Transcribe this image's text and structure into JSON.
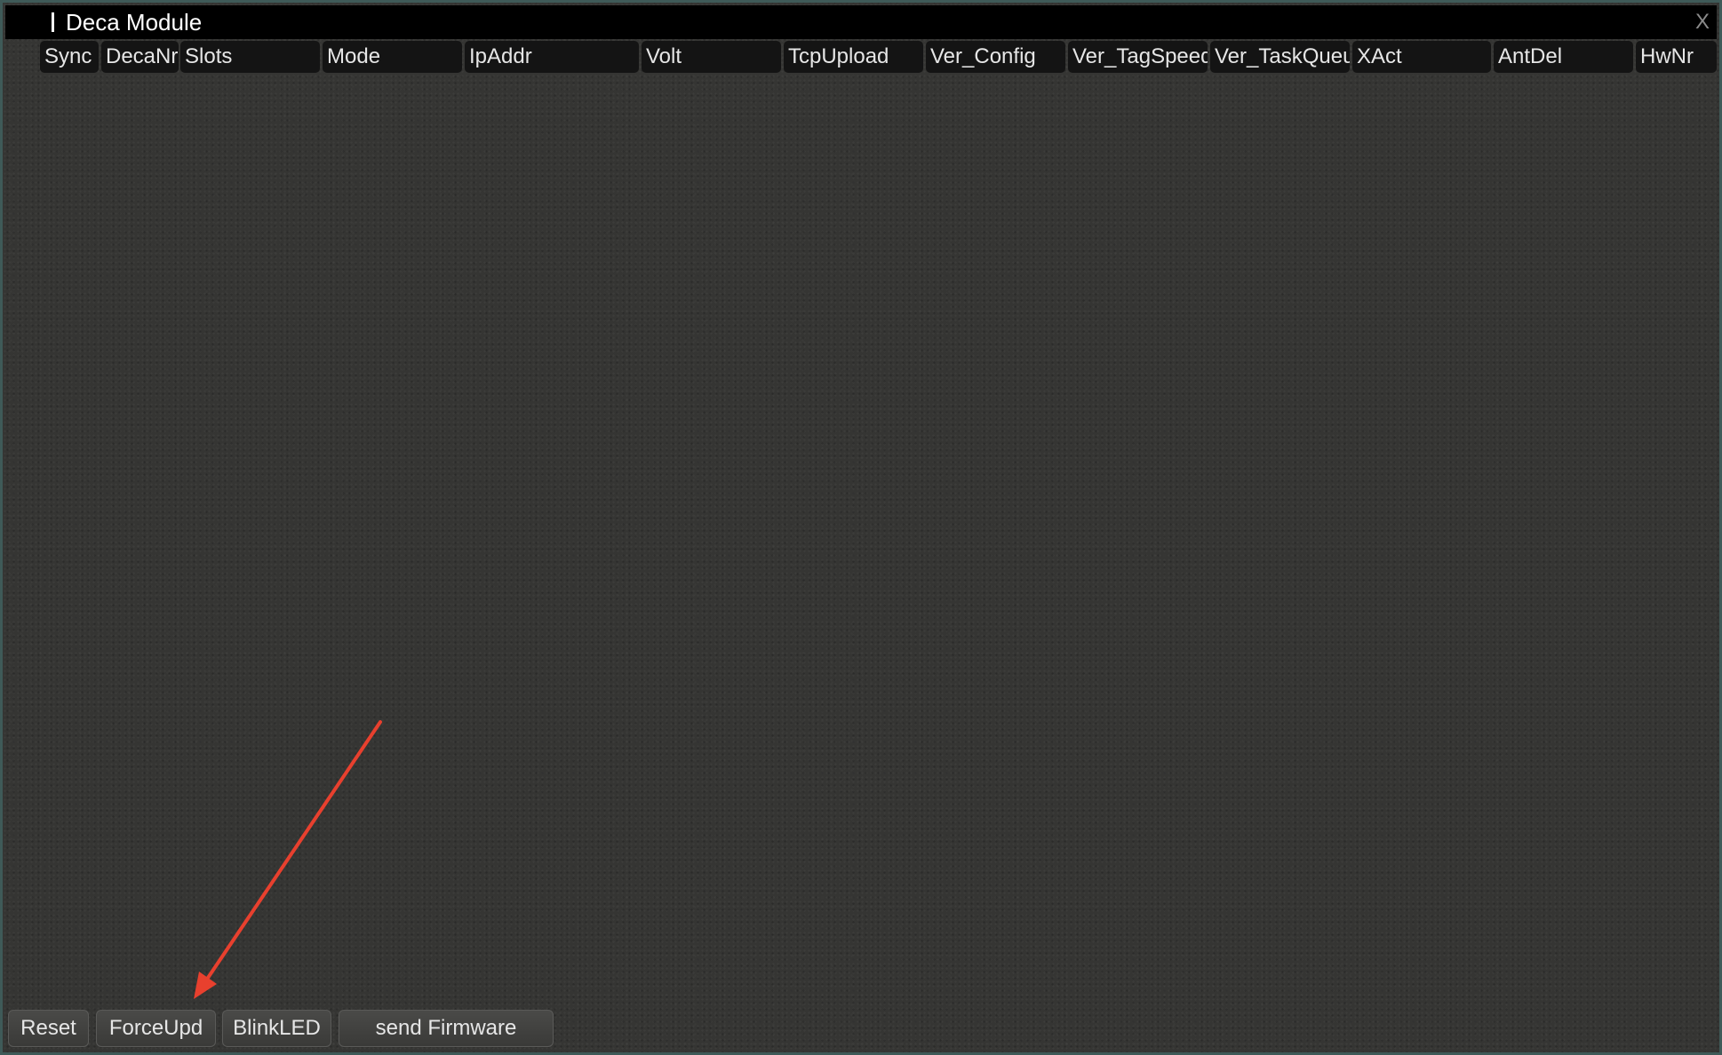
{
  "window": {
    "title": "Deca Module",
    "close_label": "X"
  },
  "columns": [
    "Sync",
    "DecaNr",
    "Slots",
    "Mode",
    "IpAddr",
    "Volt",
    "TcpUpload",
    "Ver_Config",
    "Ver_TagSpeed",
    "Ver_TaskQueue",
    "XAct",
    "AntDel",
    "HwNr"
  ],
  "buttons": {
    "reset": "Reset",
    "force_update": "ForceUpd",
    "blink_led": "BlinkLED",
    "send_firmware": "send Firmware"
  },
  "annotation": {
    "arrow_color": "#e8402e"
  },
  "colors": {
    "background": "#353533",
    "titlebar": "#000000",
    "header_cell": "#141414",
    "border": "#3f5a58"
  }
}
